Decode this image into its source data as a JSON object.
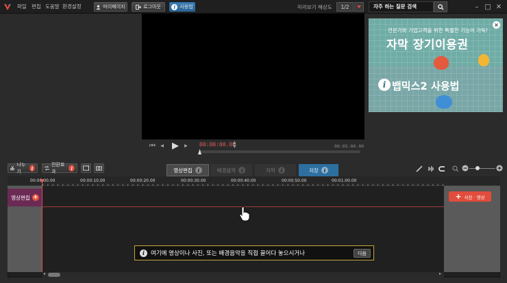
{
  "menu": [
    "파일",
    "편집",
    "도움말",
    "환경설정"
  ],
  "topbar": {
    "mypage": "마이페이지",
    "logout": "로그아웃",
    "usage": "사용법",
    "preview_res_label": "미리보기 해상도",
    "preview_res_value": "1/2",
    "faq_search": "자주 하는 질문 검색"
  },
  "player": {
    "timecode": "00:00:00.00",
    "total": "00:05:00.00"
  },
  "ad": {
    "line1": "전문가와 기업고객을 위한 특별한 기능이 가득!",
    "line2": "자막 장기이용권",
    "line3": "뱁믹스2 사용법"
  },
  "toolbar": {
    "split": "나누기",
    "transition": "전환효과"
  },
  "tabs": {
    "video_edit": "영상편집",
    "bgm": "배경음악",
    "subtitle": "자막",
    "save": "저장"
  },
  "ruler": [
    "00:00:00.00",
    "00:00:10.00",
    "00:00:20.00",
    "00:00:30.00",
    "00:00:40.00",
    "00:00:50.00",
    "00:01:00.00"
  ],
  "timeline": {
    "track_label": "영상편집",
    "add_media": "사진 · 영상",
    "hint": "여기에 영상이나 사진, 또는 배경음악을 직접 끌어다 놓으시거나",
    "next": "다음"
  },
  "colors": {
    "accent_red": "#e14c3c",
    "accent_blue": "#3c7fb5",
    "track_purple": "#6b2a54",
    "timecode_red": "#e05a5a"
  }
}
